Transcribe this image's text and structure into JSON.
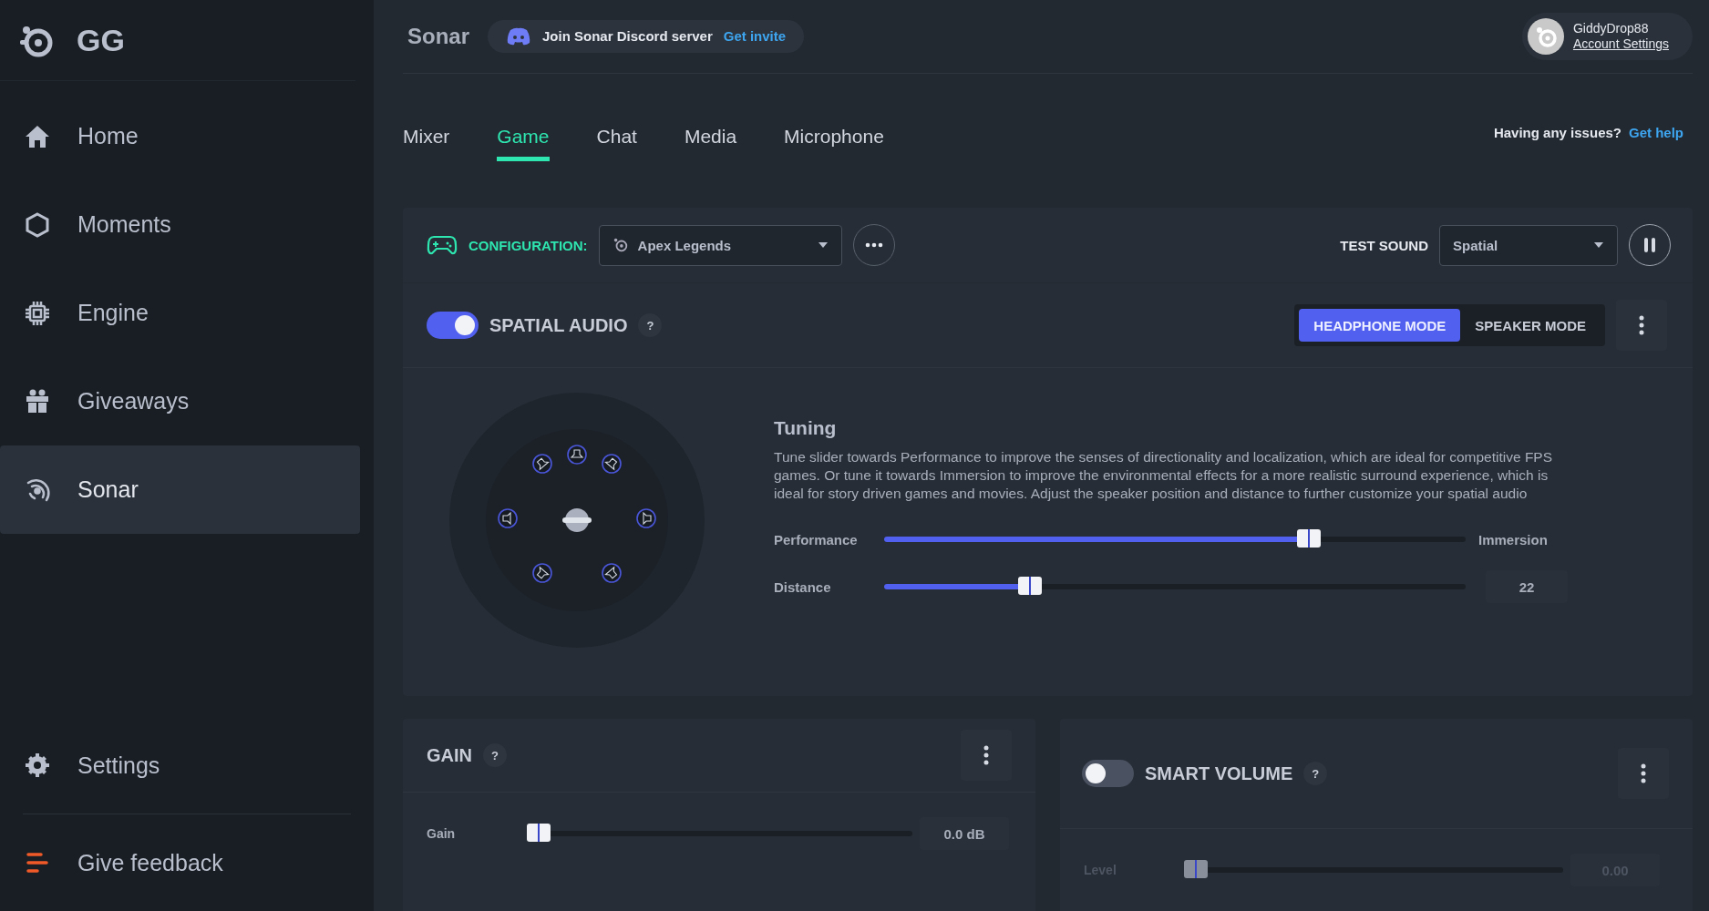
{
  "sidebar": {
    "logo": "GG",
    "items": [
      {
        "label": "Home",
        "kind": "home",
        "selected": false
      },
      {
        "label": "Moments",
        "kind": "hexagon",
        "selected": false
      },
      {
        "label": "Engine",
        "kind": "chip",
        "selected": false
      },
      {
        "label": "Giveaways",
        "kind": "gift",
        "selected": false
      },
      {
        "label": "Sonar",
        "kind": "sonar",
        "selected": true
      }
    ],
    "bottom_items": [
      {
        "label": "Settings",
        "kind": "gear"
      },
      {
        "label": "Give feedback",
        "kind": "feedback"
      }
    ]
  },
  "header": {
    "title": "Sonar",
    "discord": {
      "text": "Join Sonar Discord server",
      "link": "Get invite"
    },
    "account": {
      "username": "GiddyDrop88",
      "link": "Account Settings"
    }
  },
  "tabs": [
    {
      "label": "Mixer",
      "selected": false
    },
    {
      "label": "Game",
      "selected": true
    },
    {
      "label": "Chat",
      "selected": false
    },
    {
      "label": "Media",
      "selected": false
    },
    {
      "label": "Microphone",
      "selected": false
    }
  ],
  "help": {
    "text": "Having any issues?",
    "link": "Get help"
  },
  "configuration": {
    "label": "CONFIGURATION:",
    "value": "Apex Legends"
  },
  "test_sound": {
    "label": "TEST SOUND",
    "value": "Spatial"
  },
  "spatial_audio": {
    "title": "SPATIAL AUDIO",
    "help": "?",
    "on": true,
    "modes": [
      {
        "label": "HEADPHONE MODE",
        "selected": true
      },
      {
        "label": "SPEAKER MODE",
        "selected": false
      }
    ],
    "tuning": {
      "title": "Tuning",
      "description": "Tune slider towards Performance to improve the senses of directionality and localization, which are ideal for competitive FPS games. Or tune it towards Immersion to improve the environmental effects for a more realistic surround experience, which is ideal for story driven games and movies. Adjust the speaker position and distance to further customize your spatial audio",
      "sliders": [
        {
          "label": "Performance",
          "level": 0.74,
          "end_label": "Immersion"
        },
        {
          "label": "Distance",
          "level": 0.24,
          "reading": "22"
        }
      ]
    }
  },
  "gain": {
    "title": "GAIN",
    "help": "?",
    "slider": {
      "label": "Gain",
      "level": 0,
      "reading": "0.0 dB"
    }
  },
  "smart_volume": {
    "title": "SMART VOLUME",
    "help": "?",
    "on": false,
    "slider": {
      "label": "Level",
      "level": 0,
      "reading": "0.00",
      "disabled": true
    }
  }
}
